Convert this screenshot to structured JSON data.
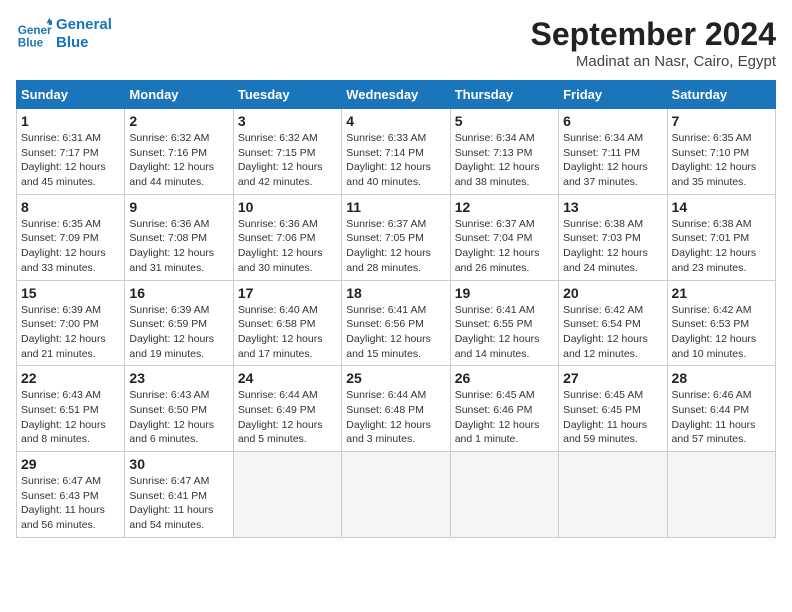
{
  "header": {
    "logo_line1": "General",
    "logo_line2": "Blue",
    "month": "September 2024",
    "location": "Madinat an Nasr, Cairo, Egypt"
  },
  "weekdays": [
    "Sunday",
    "Monday",
    "Tuesday",
    "Wednesday",
    "Thursday",
    "Friday",
    "Saturday"
  ],
  "weeks": [
    [
      {
        "day": "1",
        "sunrise": "6:31 AM",
        "sunset": "7:17 PM",
        "daylight": "12 hours and 45 minutes."
      },
      {
        "day": "2",
        "sunrise": "6:32 AM",
        "sunset": "7:16 PM",
        "daylight": "12 hours and 44 minutes."
      },
      {
        "day": "3",
        "sunrise": "6:32 AM",
        "sunset": "7:15 PM",
        "daylight": "12 hours and 42 minutes."
      },
      {
        "day": "4",
        "sunrise": "6:33 AM",
        "sunset": "7:14 PM",
        "daylight": "12 hours and 40 minutes."
      },
      {
        "day": "5",
        "sunrise": "6:34 AM",
        "sunset": "7:13 PM",
        "daylight": "12 hours and 38 minutes."
      },
      {
        "day": "6",
        "sunrise": "6:34 AM",
        "sunset": "7:11 PM",
        "daylight": "12 hours and 37 minutes."
      },
      {
        "day": "7",
        "sunrise": "6:35 AM",
        "sunset": "7:10 PM",
        "daylight": "12 hours and 35 minutes."
      }
    ],
    [
      {
        "day": "8",
        "sunrise": "6:35 AM",
        "sunset": "7:09 PM",
        "daylight": "12 hours and 33 minutes."
      },
      {
        "day": "9",
        "sunrise": "6:36 AM",
        "sunset": "7:08 PM",
        "daylight": "12 hours and 31 minutes."
      },
      {
        "day": "10",
        "sunrise": "6:36 AM",
        "sunset": "7:06 PM",
        "daylight": "12 hours and 30 minutes."
      },
      {
        "day": "11",
        "sunrise": "6:37 AM",
        "sunset": "7:05 PM",
        "daylight": "12 hours and 28 minutes."
      },
      {
        "day": "12",
        "sunrise": "6:37 AM",
        "sunset": "7:04 PM",
        "daylight": "12 hours and 26 minutes."
      },
      {
        "day": "13",
        "sunrise": "6:38 AM",
        "sunset": "7:03 PM",
        "daylight": "12 hours and 24 minutes."
      },
      {
        "day": "14",
        "sunrise": "6:38 AM",
        "sunset": "7:01 PM",
        "daylight": "12 hours and 23 minutes."
      }
    ],
    [
      {
        "day": "15",
        "sunrise": "6:39 AM",
        "sunset": "7:00 PM",
        "daylight": "12 hours and 21 minutes."
      },
      {
        "day": "16",
        "sunrise": "6:39 AM",
        "sunset": "6:59 PM",
        "daylight": "12 hours and 19 minutes."
      },
      {
        "day": "17",
        "sunrise": "6:40 AM",
        "sunset": "6:58 PM",
        "daylight": "12 hours and 17 minutes."
      },
      {
        "day": "18",
        "sunrise": "6:41 AM",
        "sunset": "6:56 PM",
        "daylight": "12 hours and 15 minutes."
      },
      {
        "day": "19",
        "sunrise": "6:41 AM",
        "sunset": "6:55 PM",
        "daylight": "12 hours and 14 minutes."
      },
      {
        "day": "20",
        "sunrise": "6:42 AM",
        "sunset": "6:54 PM",
        "daylight": "12 hours and 12 minutes."
      },
      {
        "day": "21",
        "sunrise": "6:42 AM",
        "sunset": "6:53 PM",
        "daylight": "12 hours and 10 minutes."
      }
    ],
    [
      {
        "day": "22",
        "sunrise": "6:43 AM",
        "sunset": "6:51 PM",
        "daylight": "12 hours and 8 minutes."
      },
      {
        "day": "23",
        "sunrise": "6:43 AM",
        "sunset": "6:50 PM",
        "daylight": "12 hours and 6 minutes."
      },
      {
        "day": "24",
        "sunrise": "6:44 AM",
        "sunset": "6:49 PM",
        "daylight": "12 hours and 5 minutes."
      },
      {
        "day": "25",
        "sunrise": "6:44 AM",
        "sunset": "6:48 PM",
        "daylight": "12 hours and 3 minutes."
      },
      {
        "day": "26",
        "sunrise": "6:45 AM",
        "sunset": "6:46 PM",
        "daylight": "12 hours and 1 minute."
      },
      {
        "day": "27",
        "sunrise": "6:45 AM",
        "sunset": "6:45 PM",
        "daylight": "11 hours and 59 minutes."
      },
      {
        "day": "28",
        "sunrise": "6:46 AM",
        "sunset": "6:44 PM",
        "daylight": "11 hours and 57 minutes."
      }
    ],
    [
      {
        "day": "29",
        "sunrise": "6:47 AM",
        "sunset": "6:43 PM",
        "daylight": "11 hours and 56 minutes."
      },
      {
        "day": "30",
        "sunrise": "6:47 AM",
        "sunset": "6:41 PM",
        "daylight": "11 hours and 54 minutes."
      },
      null,
      null,
      null,
      null,
      null
    ]
  ]
}
